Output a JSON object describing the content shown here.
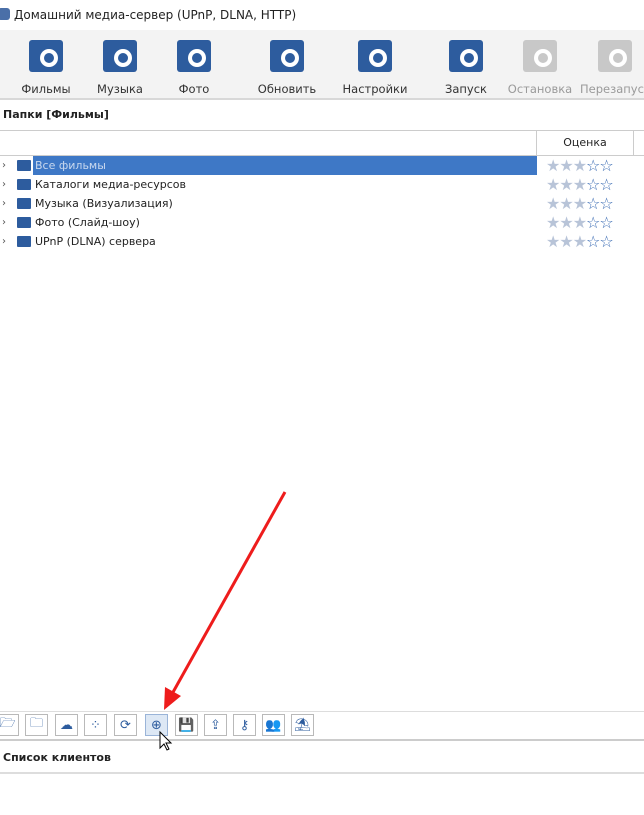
{
  "window": {
    "title": "Домашний медиа-сервер (UPnP, DLNA, HTTP)"
  },
  "toolbar": [
    {
      "label": "Фильмы",
      "icon": "movies-folder-icon",
      "enabled": true
    },
    {
      "label": "Музыка",
      "icon": "music-folder-icon",
      "enabled": true
    },
    {
      "label": "Фото",
      "icon": "photo-icon",
      "enabled": true
    },
    {
      "label": "Обновить",
      "icon": "refresh-icon",
      "enabled": true
    },
    {
      "label": "Настройки",
      "icon": "settings-icon",
      "enabled": true
    },
    {
      "label": "Запуск",
      "icon": "server-start-icon",
      "enabled": true
    },
    {
      "label": "Остановка",
      "icon": "server-stop-icon",
      "enabled": false
    },
    {
      "label": "Перезапуск",
      "icon": "server-restart-icon",
      "enabled": false
    }
  ],
  "folders": {
    "title": "Папки [Фильмы]",
    "rating_column": "Оценка",
    "items": [
      {
        "label": "Все фильмы",
        "rating": 3,
        "selected": true
      },
      {
        "label": "Каталоги медиа-ресурсов",
        "rating": 3
      },
      {
        "label": "Музыка (Визуализация)",
        "rating": 3
      },
      {
        "label": "Фото (Слайд-шоу)",
        "rating": 3
      },
      {
        "label": "UPnP (DLNA) сервера",
        "rating": 3
      }
    ]
  },
  "bottom_toolbar": [
    "open-folder-icon",
    "folder-settings-icon",
    "weather-icon",
    "dots-icon",
    "folder-refresh-icon",
    "lifebuoy-icon",
    "save-icon",
    "folder-upload-icon",
    "key-icon",
    "users-icon",
    "beach-icon"
  ],
  "clients": {
    "title": "Список клиентов"
  },
  "colors": {
    "accent": "#2d5c9e",
    "selection": "#3e78c6",
    "arrow": "#ee1c1c"
  }
}
